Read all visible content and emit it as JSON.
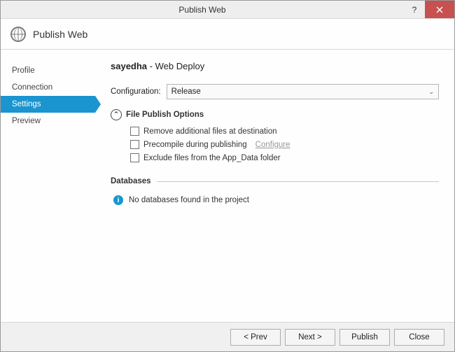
{
  "titlebar": {
    "title": "Publish Web"
  },
  "header": {
    "title": "Publish Web"
  },
  "sidebar": {
    "items": [
      {
        "label": "Profile",
        "active": false
      },
      {
        "label": "Connection",
        "active": false
      },
      {
        "label": "Settings",
        "active": true
      },
      {
        "label": "Preview",
        "active": false
      }
    ]
  },
  "main": {
    "profile_name": "sayedha",
    "profile_method": "Web Deploy",
    "configuration_label": "Configuration:",
    "configuration_value": "Release",
    "file_options_header": "File Publish Options",
    "opts": {
      "remove_additional": "Remove additional files at destination",
      "precompile": "Precompile during publishing",
      "precompile_configure": "Configure",
      "exclude_appdata": "Exclude files from the App_Data folder"
    },
    "databases_header": "Databases",
    "no_db_msg": "No databases found in the project"
  },
  "footer": {
    "prev": "< Prev",
    "next": "Next >",
    "publish": "Publish",
    "close": "Close"
  }
}
